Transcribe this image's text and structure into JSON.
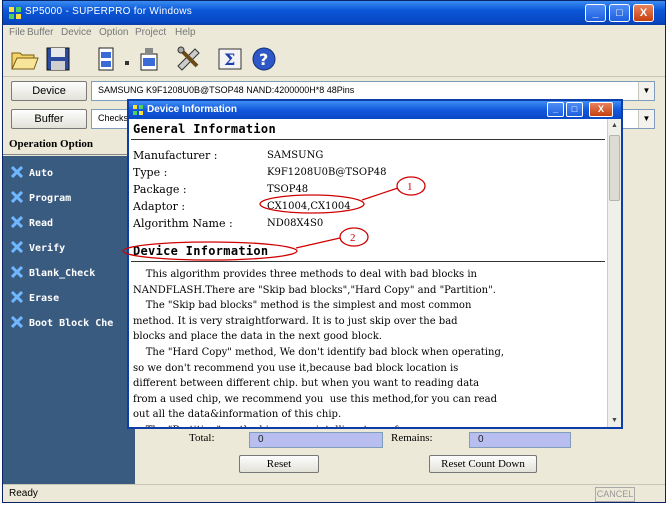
{
  "window": {
    "title": "SP5000 - SUPERPRO for Windows",
    "minimize": "_",
    "maximize": "□",
    "close": "X"
  },
  "menu": [
    "File",
    "Buffer",
    "Device",
    "Option",
    "Project",
    "Help"
  ],
  "toolbar": {
    "icons": [
      "open-folder-icon",
      "save-disk-icon",
      "chip-load-icon",
      "chip-save-icon",
      "settings-tools-icon",
      "checksum-sigma-icon",
      "help-icon"
    ]
  },
  "device": {
    "button_label": "Device",
    "value": "SAMSUNG  K9F1208U0B@TSOP48  NAND:4200000H*8  48Pins"
  },
  "buffer": {
    "button_label": "Buffer",
    "value": "Checks"
  },
  "operation": {
    "header": "Operation Option",
    "items": [
      "Auto",
      "Program",
      "Read",
      "Verify",
      "Blank_Check",
      "Erase",
      "Boot Block Che"
    ]
  },
  "stats": {
    "total_label": "Total:",
    "total_value": "0",
    "remains_label": "Remains:",
    "remains_value": "0",
    "reset_label": "Reset",
    "reset_count_label": "Reset Count Down"
  },
  "status": {
    "text": "Ready",
    "cancel": "CANCEL"
  },
  "dialog": {
    "title": "Device Information",
    "general_title": "General Information",
    "fields": [
      {
        "label": "Manufacturer :",
        "value": "SAMSUNG"
      },
      {
        "label": "Type :",
        "value": "K9F1208U0B@TSOP48"
      },
      {
        "label": "Package :",
        "value": "TSOP48"
      },
      {
        "label": "Adaptor :",
        "value": "CX1004,CX1004"
      },
      {
        "label": "Algorithm Name :",
        "value": "ND08X4S0"
      }
    ],
    "device_info_title": "Device Information",
    "paragraph": "    This algorithm provides three methods to deal with bad blocks in\nNANDFLASH.There are \"Skip bad blocks\",\"Hard Copy\" and \"Partition\".\n    The \"Skip bad blocks\" method is the simplest and most common\nmethod. It is very straightforward. It is to just skip over the bad\nblocks and place the data in the next good block.\n    The \"Hard Copy\" method, We don't identify bad block when operating,\nso we don't recommend you use it,because bad block location is\ndifferent between different chip. but when you want to reading data\nfrom a used chip, we recommend you  use this method,for you can read\nout all the data&information of this chip.\n    The \"Partition\" method is a more intelligent way for"
  },
  "annotations": {
    "first": "1",
    "second": "2"
  },
  "colors": {
    "accent_blue": "#0a56d8",
    "op_panel": "#3a5b80",
    "annotation_red": "#d00000"
  }
}
